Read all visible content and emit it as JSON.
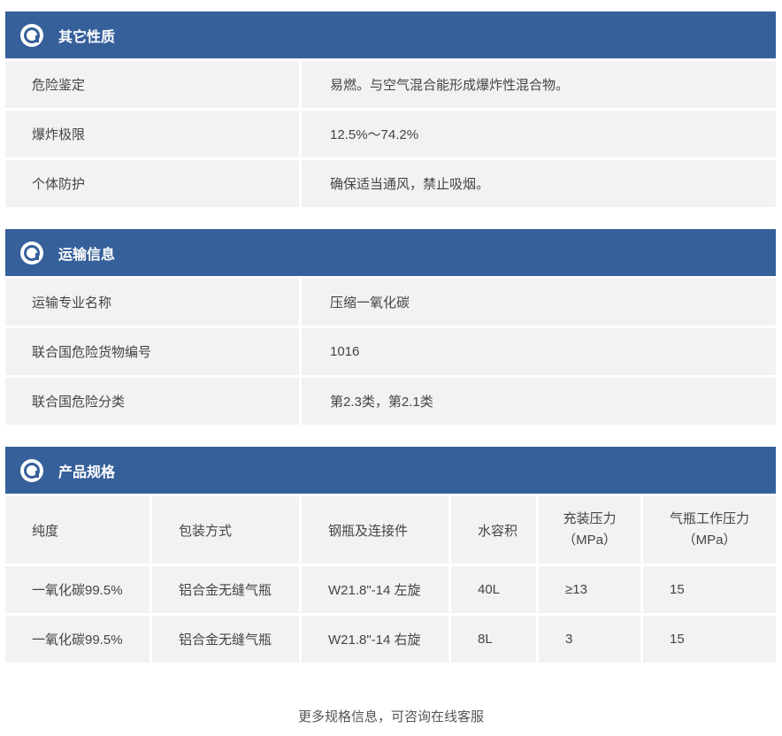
{
  "sections": [
    {
      "title": "其它性质",
      "rows": [
        {
          "key": "危险鉴定",
          "value": "易燃。与空气混合能形成爆炸性混合物。"
        },
        {
          "key": "爆炸极限",
          "value": "12.5%～74.2%"
        },
        {
          "key": "个体防护",
          "value": "确保适当通风，禁止吸烟。"
        }
      ]
    },
    {
      "title": "运输信息",
      "rows": [
        {
          "key": "运输专业名称",
          "value": "压缩一氧化碳"
        },
        {
          "key": "联合国危险货物编号",
          "value": "1016"
        },
        {
          "key": "联合国危险分类",
          "value": "第2.3类，第2.1类"
        }
      ]
    }
  ],
  "spec": {
    "title": "产品规格",
    "headers": {
      "purity": "纯度",
      "packaging": "包装方式",
      "cylinder": "钢瓶及连接件",
      "water_volume": "水容积",
      "fill_pressure": "充装压力",
      "fill_pressure_unit": "（MPa）",
      "work_pressure": "气瓶工作压力",
      "work_pressure_unit": "（MPa）"
    },
    "rows": [
      {
        "purity": "一氧化碳99.5%",
        "packaging": "铝合金无缝气瓶",
        "cylinder": "W21.8\"-14 左旋",
        "water_volume": "40L",
        "fill_pressure": "≥13",
        "work_pressure": "15"
      },
      {
        "purity": "一氧化碳99.5%",
        "packaging": "铝合金无缝气瓶",
        "cylinder": "W21.8\"-14 右旋",
        "water_volume": "8L",
        "fill_pressure": "3",
        "work_pressure": "15"
      }
    ]
  },
  "footer": "更多规格信息，可咨询在线客服",
  "colors": {
    "header_bg": "#36609a",
    "row_bg": "#f2f2f2"
  }
}
